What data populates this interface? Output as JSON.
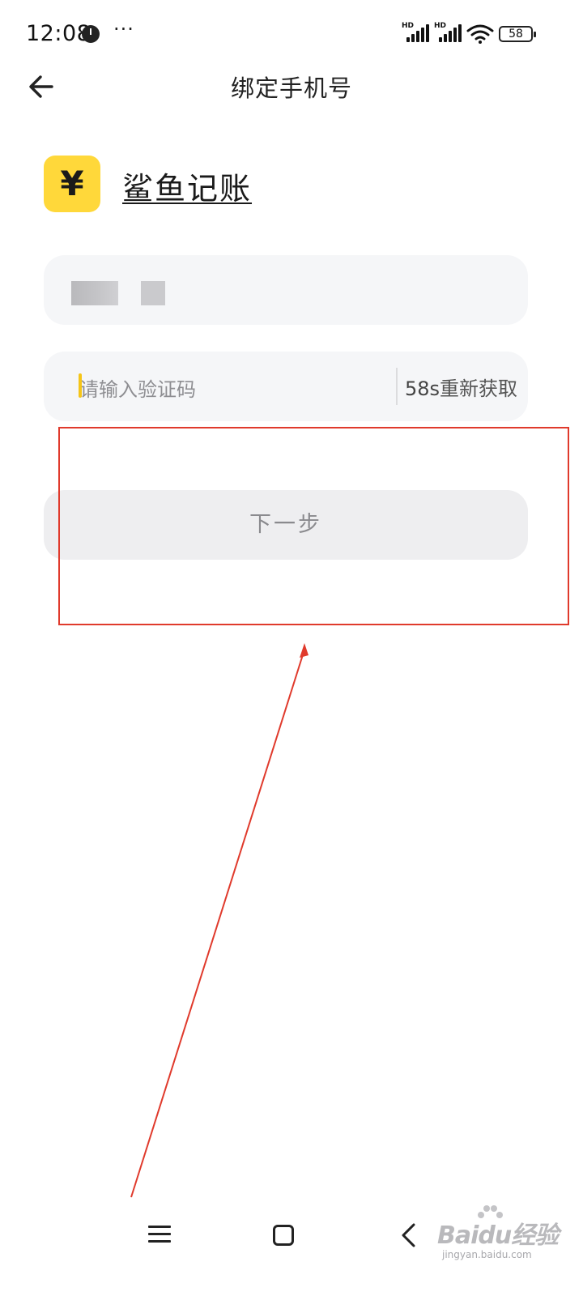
{
  "status_bar": {
    "time": "12:08",
    "more": "···",
    "signal_1": {
      "label": "HD"
    },
    "signal_2": {
      "label": "HD"
    },
    "battery": "58"
  },
  "header": {
    "back_icon": "arrow-left-icon",
    "title": "绑定手机号"
  },
  "brand": {
    "logo_glyph": "¥",
    "logo_color": "#ffd83a",
    "name": "鲨鱼记账"
  },
  "form": {
    "phone_value_note": "",
    "code_placeholder": "请输入验证码",
    "resend_countdown": "58s",
    "resend_label": "重新获取",
    "next_label": "下一步"
  },
  "annotation": {
    "color": "#e03a2c"
  },
  "nav_bar": {
    "menu_icon": "menu-icon",
    "home_icon": "home-icon",
    "back_icon": "back-chevron-icon"
  },
  "watermark": {
    "main": "Baidu经验",
    "sub": "jingyan.baidu.com"
  }
}
